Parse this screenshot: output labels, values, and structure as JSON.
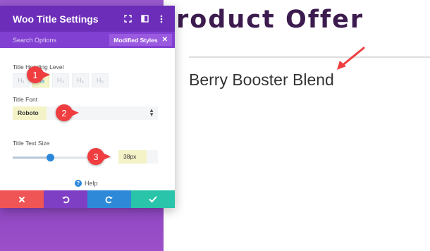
{
  "page": {
    "title": "roduct Offer",
    "product_title": "Berry Booster Blend"
  },
  "panel": {
    "title": "Woo Title Settings",
    "search_label": "Search Options",
    "modified_styles_label": "Modified Styles",
    "heading_level": {
      "label": "Title Heading Level",
      "options": [
        "H₁",
        "H₃",
        "H₄",
        "H₅",
        "H₆"
      ],
      "selected": "H₃"
    },
    "font": {
      "label": "Title Font",
      "value": "Roboto"
    },
    "text_size": {
      "label": "Title Text Size",
      "value": "38px",
      "slider_fraction": 0.38
    },
    "help_label": "Help"
  },
  "annotations": [
    "1",
    "2",
    "3"
  ],
  "colors": {
    "header": "#6c2eb9",
    "subbar": "#8240d2",
    "page_title": "#3c1b4e",
    "close": "#ef5555",
    "undo": "#7e3fc4",
    "redo": "#2e8ad8",
    "save": "#29c4a9",
    "annotation": "#ef3d40"
  }
}
